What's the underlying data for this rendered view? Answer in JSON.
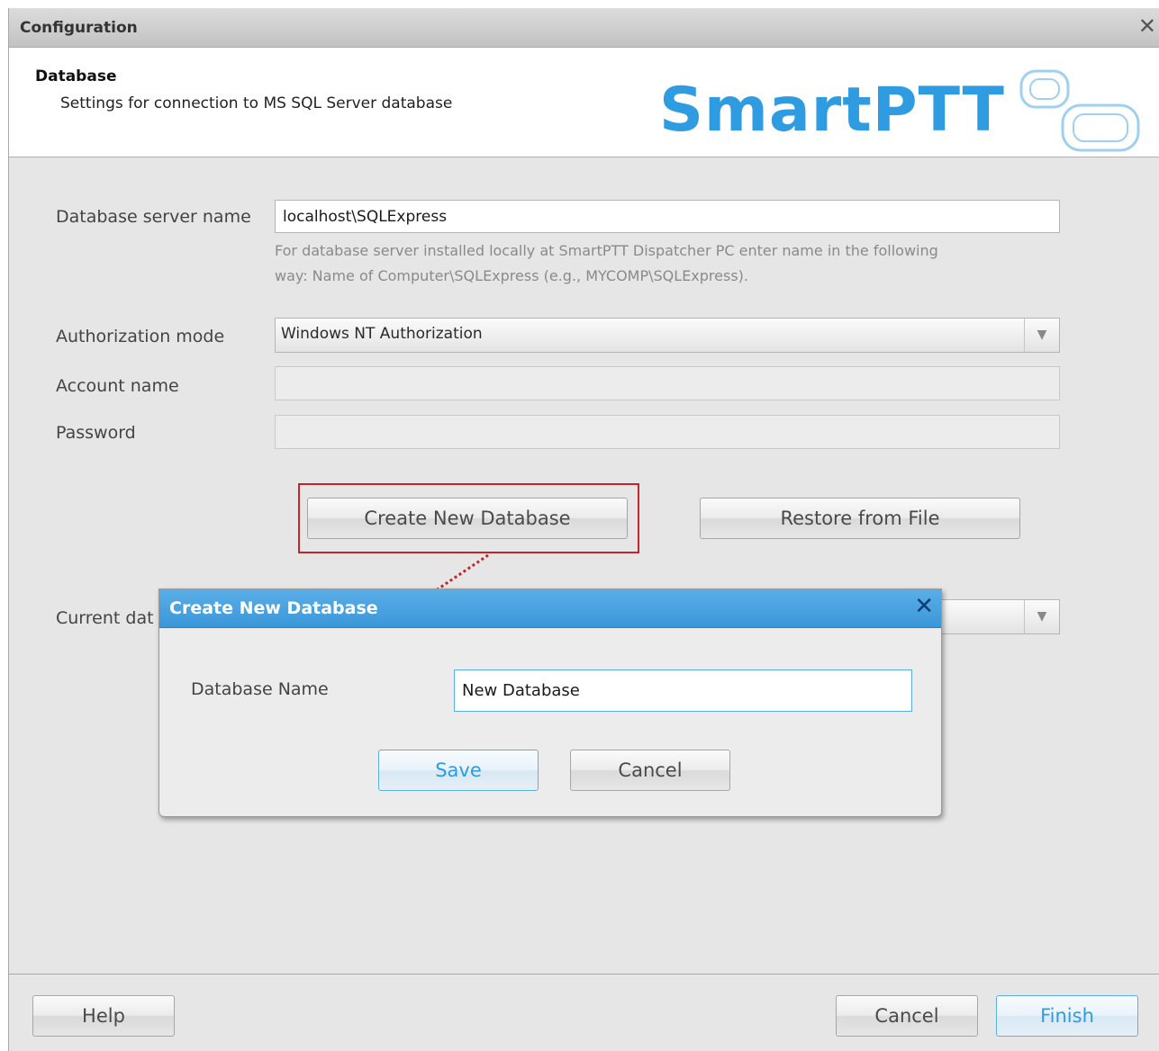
{
  "window": {
    "title": "Configuration",
    "close_glyph": "✕"
  },
  "header": {
    "title": "Database",
    "subtitle": "Settings for connection to MS SQL Server database",
    "logo_text": "SmartPTT"
  },
  "form": {
    "server_name": {
      "label": "Database server name",
      "value": "localhost\\SQLExpress",
      "hint_line1": "For database server installed locally at SmartPTT Dispatcher PC enter name in the following",
      "hint_line2": "way: Name of Computer\\SQLExpress (e.g., MYCOMP\\SQLExpress)."
    },
    "auth_mode": {
      "label": "Authorization mode",
      "value": "Windows NT Authorization"
    },
    "account_name": {
      "label": "Account name",
      "value": ""
    },
    "password": {
      "label": "Password",
      "value": ""
    },
    "create_db_button": "Create New Database",
    "restore_button": "Restore from File",
    "current_db": {
      "label_visible": "Current dat",
      "value": ""
    }
  },
  "dialog": {
    "title": "Create New Database",
    "close_glyph": "✕",
    "db_name_label": "Database Name",
    "db_name_value": "New Database",
    "save_button": "Save",
    "cancel_button": "Cancel"
  },
  "footer": {
    "help_button": "Help",
    "cancel_button": "Cancel",
    "finish_button": "Finish"
  },
  "colors": {
    "accent_blue": "#3b97d9",
    "highlight_red": "#c3262b",
    "logo_blue": "#2f9be0"
  }
}
